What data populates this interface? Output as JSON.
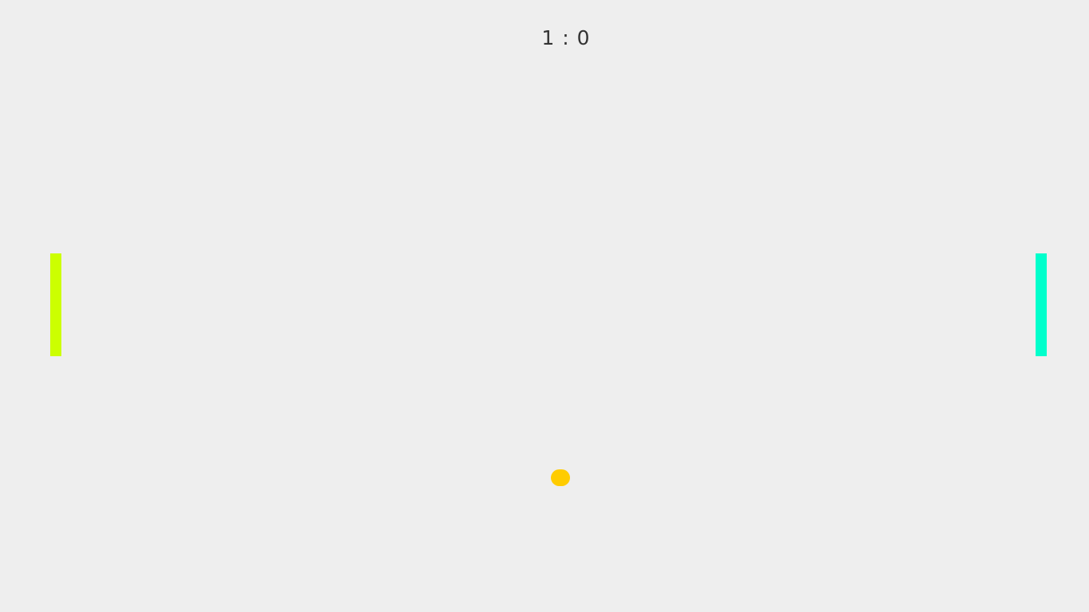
{
  "score": {
    "left": "1",
    "separator": ":",
    "right": "0"
  },
  "colors": {
    "background": "#eeeeee",
    "score_text": "#333333",
    "left_paddle": "#ccff00",
    "right_paddle": "#00ffcc",
    "ball": "#ffcc00"
  }
}
